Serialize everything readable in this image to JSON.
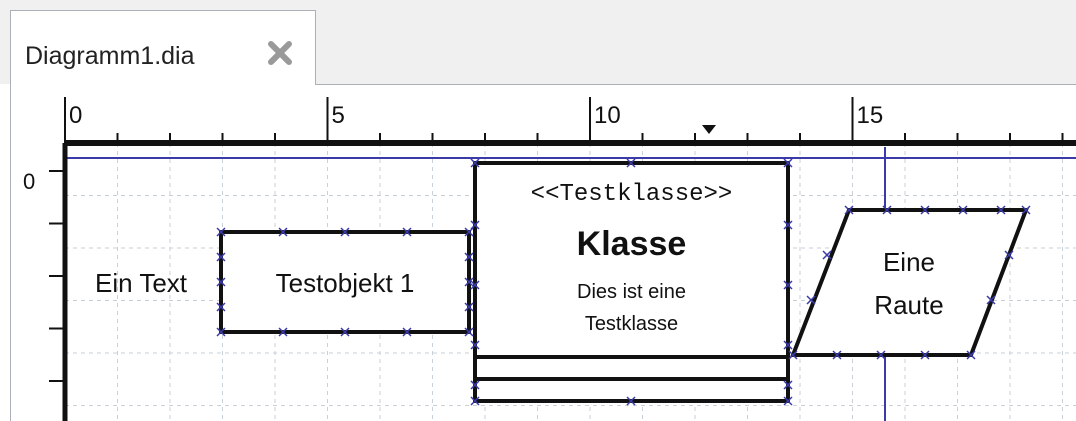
{
  "tab": {
    "title": "Diagramm1.dia",
    "close_icon": "close-x-icon"
  },
  "ruler": {
    "horizontal_labels": [
      "0",
      "5",
      "10",
      "15"
    ],
    "vertical_labels": [
      "0"
    ]
  },
  "diagram": {
    "text_object": "Ein Text",
    "box_object": "Testobjekt 1",
    "uml_class": {
      "stereotype": "<<Testklasse>>",
      "name": "Klasse",
      "comment_line1": "Dies ist eine",
      "comment_line2": "Testklasse"
    },
    "parallelogram": {
      "line1": "Eine",
      "line2": "Raute"
    }
  },
  "colors": {
    "guide": "#3a3aa8",
    "grid": "#c8d0d8",
    "handle": "#3a3aa8",
    "outline": "#111111"
  }
}
